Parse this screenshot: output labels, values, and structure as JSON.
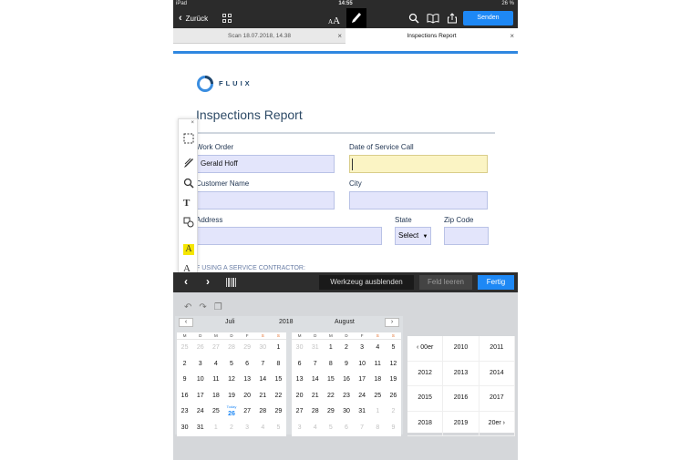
{
  "statusbar": {
    "device": "iPad",
    "time": "14:55",
    "battery": "26 %"
  },
  "navbar": {
    "back_label": "Zurück",
    "textsize_small": "A",
    "textsize_big": "A",
    "send_label": "Senden"
  },
  "tabs": [
    {
      "label": "Scan 18.07.2018, 14.38"
    },
    {
      "label": "Inspections Report"
    }
  ],
  "document": {
    "logo_text": "FLUIX",
    "title": "Inspections Report",
    "fields": {
      "work_order_label": "Work Order",
      "work_order_value": "Gerald Hoff",
      "date_service_label": "Date of Service Call",
      "date_service_value": "",
      "customer_name_label": "Customer Name",
      "customer_name_value": "",
      "city_label": "City",
      "city_value": "",
      "address_label": "Address",
      "address_value": "",
      "state_label": "State",
      "state_value": "Select",
      "zip_label": "Zip Code",
      "zip_value": ""
    },
    "service_contractor_text": "F USING A SERVICE CONTRACTOR:"
  },
  "palette": {
    "tools": [
      "select-rect-icon",
      "pen-icon",
      "magnifier-icon",
      "text-icon",
      "shapes-icon",
      "highlight-icon",
      "font-icon"
    ]
  },
  "keyboard_toolbar": {
    "hide_tool_label": "Werkzeug ausblenden",
    "clear_field_label": "Feld leeren",
    "done_label": "Fertig"
  },
  "calendar": {
    "month_left": "Juli",
    "year": "2018",
    "month_right": "August",
    "dow": [
      "M",
      "D",
      "M",
      "D",
      "F",
      "S",
      "S"
    ],
    "today_label": "Today",
    "july": [
      {
        "d": "25",
        "dim": true
      },
      {
        "d": "26",
        "dim": true
      },
      {
        "d": "27",
        "dim": true
      },
      {
        "d": "28",
        "dim": true
      },
      {
        "d": "29",
        "dim": true
      },
      {
        "d": "30",
        "dim": true
      },
      {
        "d": "1"
      },
      {
        "d": "2"
      },
      {
        "d": "3"
      },
      {
        "d": "4"
      },
      {
        "d": "5"
      },
      {
        "d": "6"
      },
      {
        "d": "7"
      },
      {
        "d": "8"
      },
      {
        "d": "9"
      },
      {
        "d": "10"
      },
      {
        "d": "11"
      },
      {
        "d": "12"
      },
      {
        "d": "13"
      },
      {
        "d": "14"
      },
      {
        "d": "15"
      },
      {
        "d": "16"
      },
      {
        "d": "17"
      },
      {
        "d": "18"
      },
      {
        "d": "19"
      },
      {
        "d": "20"
      },
      {
        "d": "21"
      },
      {
        "d": "22"
      },
      {
        "d": "23"
      },
      {
        "d": "24"
      },
      {
        "d": "25"
      },
      {
        "d": "26",
        "today": true
      },
      {
        "d": "27"
      },
      {
        "d": "28"
      },
      {
        "d": "29"
      },
      {
        "d": "30"
      },
      {
        "d": "31"
      },
      {
        "d": "1",
        "dim": true
      },
      {
        "d": "2",
        "dim": true
      },
      {
        "d": "3",
        "dim": true
      },
      {
        "d": "4",
        "dim": true
      },
      {
        "d": "5",
        "dim": true
      }
    ],
    "august": [
      {
        "d": "30",
        "dim": true
      },
      {
        "d": "31",
        "dim": true
      },
      {
        "d": "1"
      },
      {
        "d": "2"
      },
      {
        "d": "3"
      },
      {
        "d": "4"
      },
      {
        "d": "5"
      },
      {
        "d": "6"
      },
      {
        "d": "7"
      },
      {
        "d": "8"
      },
      {
        "d": "9"
      },
      {
        "d": "10"
      },
      {
        "d": "11"
      },
      {
        "d": "12"
      },
      {
        "d": "13"
      },
      {
        "d": "14"
      },
      {
        "d": "15"
      },
      {
        "d": "16"
      },
      {
        "d": "17"
      },
      {
        "d": "18"
      },
      {
        "d": "19"
      },
      {
        "d": "20"
      },
      {
        "d": "21"
      },
      {
        "d": "22"
      },
      {
        "d": "23"
      },
      {
        "d": "24"
      },
      {
        "d": "25"
      },
      {
        "d": "26"
      },
      {
        "d": "27"
      },
      {
        "d": "28"
      },
      {
        "d": "29"
      },
      {
        "d": "30"
      },
      {
        "d": "31"
      },
      {
        "d": "1",
        "dim": true
      },
      {
        "d": "2",
        "dim": true
      },
      {
        "d": "3",
        "dim": true
      },
      {
        "d": "4",
        "dim": true
      },
      {
        "d": "5",
        "dim": true
      },
      {
        "d": "6",
        "dim": true
      },
      {
        "d": "7",
        "dim": true
      },
      {
        "d": "8",
        "dim": true
      },
      {
        "d": "9",
        "dim": true
      }
    ],
    "years": [
      "‹ 00er",
      "2010",
      "2011",
      "2012",
      "2013",
      "2014",
      "2015",
      "2016",
      "2017",
      "2018",
      "2019",
      "20er ›"
    ]
  },
  "colors": {
    "accent": "#1e88f5",
    "field_bg": "#e3e5fb",
    "active_field_bg": "#fbf4c4",
    "weekend": "#e0641e"
  }
}
